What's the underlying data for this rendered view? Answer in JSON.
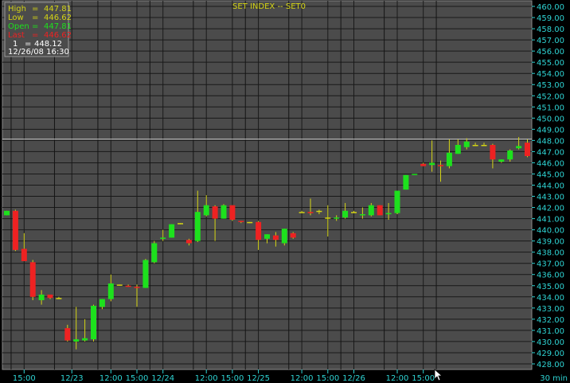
{
  "chart_data": {
    "type": "candlestick",
    "title": "SET INDEX -- SET0",
    "interval_label": "30 min",
    "y_range": [
      427.5,
      460.5
    ],
    "y_ticks": [
      428,
      429,
      430,
      431,
      432,
      433,
      434,
      435,
      436,
      437,
      438,
      439,
      440,
      441,
      442,
      443,
      444,
      445,
      446,
      447,
      448,
      449,
      450,
      451,
      452,
      453,
      454,
      455,
      456,
      457,
      458,
      459,
      460
    ],
    "current_price_line": 448.12,
    "grid": true,
    "x_tick_labels": [
      {
        "label": "15:00",
        "bar": 2
      },
      {
        "label": "12/23",
        "bar": 7.5
      },
      {
        "label": "12:00",
        "bar": 12
      },
      {
        "label": "15:00",
        "bar": 15
      },
      {
        "label": "12/24",
        "bar": 18
      },
      {
        "label": "12:00",
        "bar": 23
      },
      {
        "label": "15:00",
        "bar": 26
      },
      {
        "label": "12/25",
        "bar": 29
      },
      {
        "label": "12:00",
        "bar": 34
      },
      {
        "label": "15:00",
        "bar": 37
      },
      {
        "label": "12/26",
        "bar": 40
      },
      {
        "label": "12:00",
        "bar": 45
      },
      {
        "label": "15:00",
        "bar": 48
      }
    ],
    "session_separators": [
      5.5,
      16.5,
      27.5,
      38.5,
      49.5
    ],
    "intraday_lines": [
      0.5,
      10.5,
      21.5,
      32.5,
      43.5
    ],
    "bull_color": "#1de11d",
    "bear_color": "#ee2222",
    "doji_color": "#d4d414",
    "candles": [
      {
        "o": 441.3,
        "h": 441.3,
        "l": 441.6,
        "c": 441.7
      },
      {
        "o": 441.7,
        "h": 441.8,
        "l": 438.1,
        "c": 438.2
      },
      {
        "o": 438.3,
        "h": 439.7,
        "l": 437.5,
        "c": 437.2
      },
      {
        "o": 437.1,
        "h": 437.3,
        "l": 433.7,
        "c": 434.0
      },
      {
        "o": 433.7,
        "h": 434.6,
        "l": 433.3,
        "c": 434.2
      },
      {
        "o": 434.2,
        "h": 434.2,
        "l": 433.8,
        "c": 433.9
      },
      {
        "o": 433.9,
        "h": 434.0,
        "l": 433.8,
        "c": 433.9
      },
      {
        "o": 431.2,
        "h": 431.5,
        "l": 430.0,
        "c": 430.1
      },
      {
        "o": 430.0,
        "h": 433.1,
        "l": 429.3,
        "c": 430.2
      },
      {
        "o": 430.1,
        "h": 432.0,
        "l": 430.0,
        "c": 430.3
      },
      {
        "o": 430.2,
        "h": 433.3,
        "l": 430.0,
        "c": 433.2
      },
      {
        "o": 433.1,
        "h": 433.8,
        "l": 432.9,
        "c": 433.8
      },
      {
        "o": 433.8,
        "h": 436.0,
        "l": 433.6,
        "c": 435.2
      },
      {
        "o": 435.1,
        "h": 435.1,
        "l": 435.0,
        "c": 435.1
      },
      {
        "o": 435.0,
        "h": 435.1,
        "l": 434.9,
        "c": 434.9
      },
      {
        "o": 434.9,
        "h": 435.1,
        "l": 433.1,
        "c": 434.8
      },
      {
        "o": 434.8,
        "h": 437.4,
        "l": 434.8,
        "c": 437.3
      },
      {
        "o": 437.1,
        "h": 439.0,
        "l": 437.0,
        "c": 438.8
      },
      {
        "o": 439.2,
        "h": 440.0,
        "l": 439.0,
        "c": 439.3
      },
      {
        "o": 439.3,
        "h": 440.5,
        "l": 439.3,
        "c": 440.5
      },
      {
        "o": 440.6,
        "h": 440.6,
        "l": 440.5,
        "c": 440.6
      },
      {
        "o": 439.1,
        "h": 439.2,
        "l": 438.6,
        "c": 438.8
      },
      {
        "o": 439.0,
        "h": 443.5,
        "l": 438.9,
        "c": 441.6
      },
      {
        "o": 441.3,
        "h": 443.1,
        "l": 441.2,
        "c": 442.2
      },
      {
        "o": 442.1,
        "h": 442.2,
        "l": 439.0,
        "c": 441.0
      },
      {
        "o": 441.0,
        "h": 442.3,
        "l": 441.0,
        "c": 442.2
      },
      {
        "o": 442.2,
        "h": 442.2,
        "l": 440.8,
        "c": 440.9
      },
      {
        "o": 440.8,
        "h": 440.8,
        "l": 440.6,
        "c": 440.7
      },
      {
        "o": 440.7,
        "h": 440.7,
        "l": 440.6,
        "c": 440.7
      },
      {
        "o": 440.7,
        "h": 440.8,
        "l": 438.2,
        "c": 439.1
      },
      {
        "o": 439.2,
        "h": 439.5,
        "l": 438.8,
        "c": 439.6
      },
      {
        "o": 439.5,
        "h": 439.8,
        "l": 438.5,
        "c": 439.1
      },
      {
        "o": 438.8,
        "h": 440.1,
        "l": 438.6,
        "c": 440.1
      },
      {
        "o": 439.7,
        "h": 439.8,
        "l": 439.2,
        "c": 439.3
      },
      {
        "o": 441.6,
        "h": 441.7,
        "l": 441.6,
        "c": 441.6
      },
      {
        "o": 441.6,
        "h": 442.8,
        "l": 441.3,
        "c": 441.5
      },
      {
        "o": 441.7,
        "h": 441.8,
        "l": 441.4,
        "c": 441.7
      },
      {
        "o": 441.1,
        "h": 442.2,
        "l": 439.4,
        "c": 441.1
      },
      {
        "o": 441.0,
        "h": 441.3,
        "l": 440.8,
        "c": 441.1
      },
      {
        "o": 441.1,
        "h": 442.4,
        "l": 441.0,
        "c": 441.7
      },
      {
        "o": 441.6,
        "h": 441.7,
        "l": 441.5,
        "c": 441.6
      },
      {
        "o": 441.3,
        "h": 442.0,
        "l": 441.0,
        "c": 441.4
      },
      {
        "o": 441.3,
        "h": 442.4,
        "l": 441.2,
        "c": 442.2
      },
      {
        "o": 442.2,
        "h": 442.2,
        "l": 441.3,
        "c": 441.3
      },
      {
        "o": 441.4,
        "h": 442.4,
        "l": 440.9,
        "c": 441.5
      },
      {
        "o": 441.5,
        "h": 443.5,
        "l": 441.4,
        "c": 443.5
      },
      {
        "o": 443.6,
        "h": 444.9,
        "l": 443.6,
        "c": 444.9
      },
      {
        "o": 444.9,
        "h": 445.0,
        "l": 444.9,
        "c": 445.0
      },
      {
        "o": 445.9,
        "h": 446.0,
        "l": 445.7,
        "c": 445.7
      },
      {
        "o": 445.8,
        "h": 448.0,
        "l": 445.2,
        "c": 446.0
      },
      {
        "o": 445.8,
        "h": 446.2,
        "l": 444.3,
        "c": 445.7
      },
      {
        "o": 445.7,
        "h": 448.1,
        "l": 445.5,
        "c": 446.9
      },
      {
        "o": 446.8,
        "h": 448.1,
        "l": 446.8,
        "c": 447.6
      },
      {
        "o": 447.4,
        "h": 448.2,
        "l": 447.2,
        "c": 447.9
      },
      {
        "o": 447.6,
        "h": 447.8,
        "l": 447.5,
        "c": 447.6
      },
      {
        "o": 447.6,
        "h": 447.8,
        "l": 447.5,
        "c": 447.6
      },
      {
        "o": 447.6,
        "h": 447.7,
        "l": 445.5,
        "c": 446.3
      },
      {
        "o": 446.1,
        "h": 446.3,
        "l": 446.0,
        "c": 446.3
      },
      {
        "o": 446.3,
        "h": 447.2,
        "l": 446.1,
        "c": 447.1
      },
      {
        "o": 447.3,
        "h": 448.3,
        "l": 447.2,
        "c": 447.5
      },
      {
        "o": 447.8,
        "h": 448.1,
        "l": 446.5,
        "c": 446.6
      },
      {
        "o": 446.6,
        "h": 446.7,
        "l": 446.6,
        "c": 446.7
      }
    ]
  },
  "info_box": {
    "high_label": "High",
    "high_value": "447.81",
    "low_label": "Low",
    "low_value": "446.62",
    "open_label": "Open",
    "open_value": "447.81",
    "last_label": "Last",
    "last_value": "446.62",
    "row5_label": "1",
    "row5_value": "448.12",
    "datetime": "12/26/08  16:30",
    "eq": "="
  },
  "colors": {
    "plot_bg": "#4b4b4b",
    "grid": "#191919",
    "axis_text": "#2ed3d3",
    "title": "#d4d414",
    "info_high": "#d4d414",
    "info_low": "#d4d414",
    "info_open": "#1de11d",
    "info_last": "#ee2222",
    "info_white": "#ffffff"
  }
}
